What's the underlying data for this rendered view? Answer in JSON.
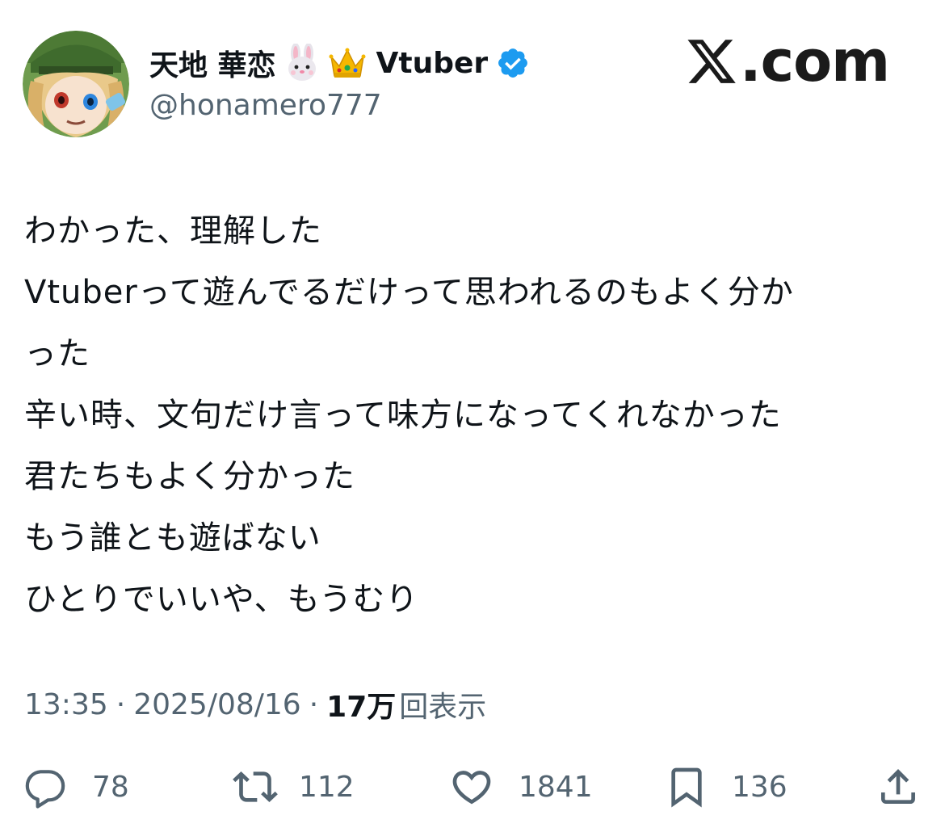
{
  "author": {
    "display_name": "天地 華恋",
    "name_suffix": "Vtuber",
    "handle": "@honamero777",
    "name_emojis": [
      "rabbit-face-icon",
      "crown-icon"
    ],
    "verified": true
  },
  "brand": {
    "logo_text": ".com",
    "logo_icon": "x-logo-icon"
  },
  "tweet": {
    "lines": [
      "わかった、理解した",
      "Vtuberって遊んでるだけって思われるのもよく分か",
      "った",
      "辛い時、文句だけ言って味方になってくれなかった",
      "君たちもよく分かった",
      "もう誰とも遊ばない",
      "ひとりでいいや、もうむり"
    ]
  },
  "meta": {
    "time": "13:35",
    "separator": "·",
    "date": "2025/08/16",
    "views_count": "17万",
    "views_label": "回表示"
  },
  "actions": {
    "replies": "78",
    "reposts": "112",
    "likes": "1841",
    "bookmarks": "136"
  },
  "colors": {
    "text": "#0f1419",
    "secondary": "#536471",
    "verified": "#1d9bf0",
    "background": "#ffffff"
  }
}
